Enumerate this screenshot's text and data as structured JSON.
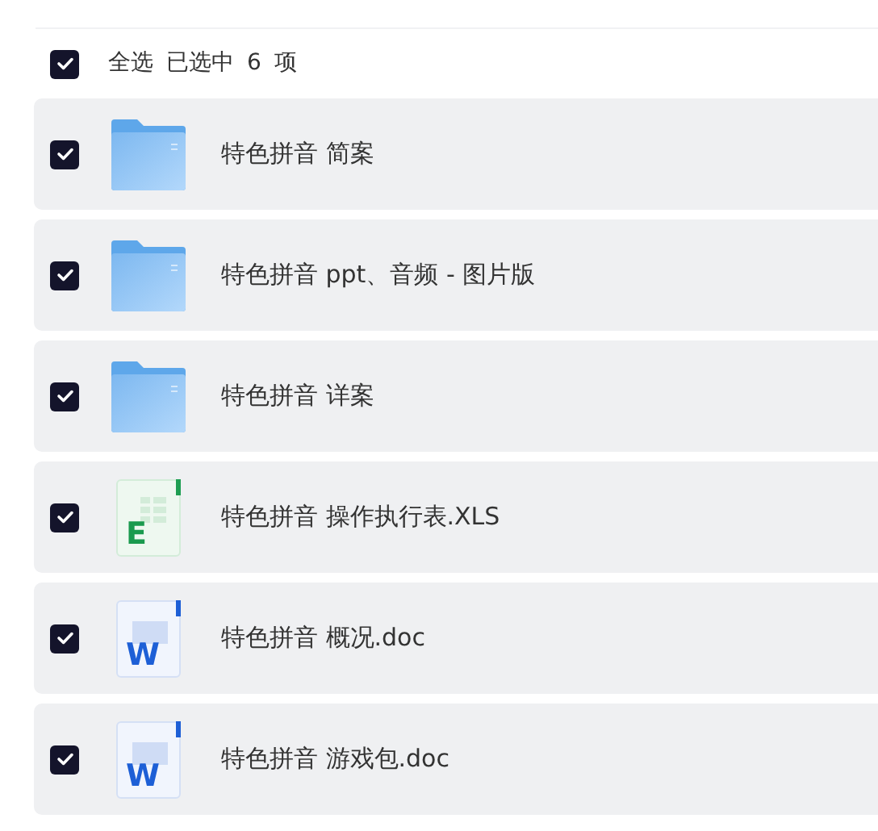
{
  "header": {
    "select_all_label": "全选",
    "checked": true,
    "selection_summary": "已选中",
    "count": "6",
    "unit": "项"
  },
  "files": [
    {
      "kind": "folder",
      "name": "特色拼音 简案",
      "checked": true
    },
    {
      "kind": "folder",
      "name": "特色拼音 ppt、音频 - 图片版",
      "checked": true
    },
    {
      "kind": "folder",
      "name": "特色拼音 详案",
      "checked": true
    },
    {
      "kind": "spreadsheet",
      "icon_text": "E",
      "name": "特色拼音 操作执行表.XLS",
      "checked": true
    },
    {
      "kind": "document",
      "icon_text": "W",
      "name": "特色拼音 概况.doc",
      "checked": true
    },
    {
      "kind": "document",
      "icon_text": "W",
      "name": "特色拼音 游戏包.doc",
      "checked": true
    }
  ]
}
